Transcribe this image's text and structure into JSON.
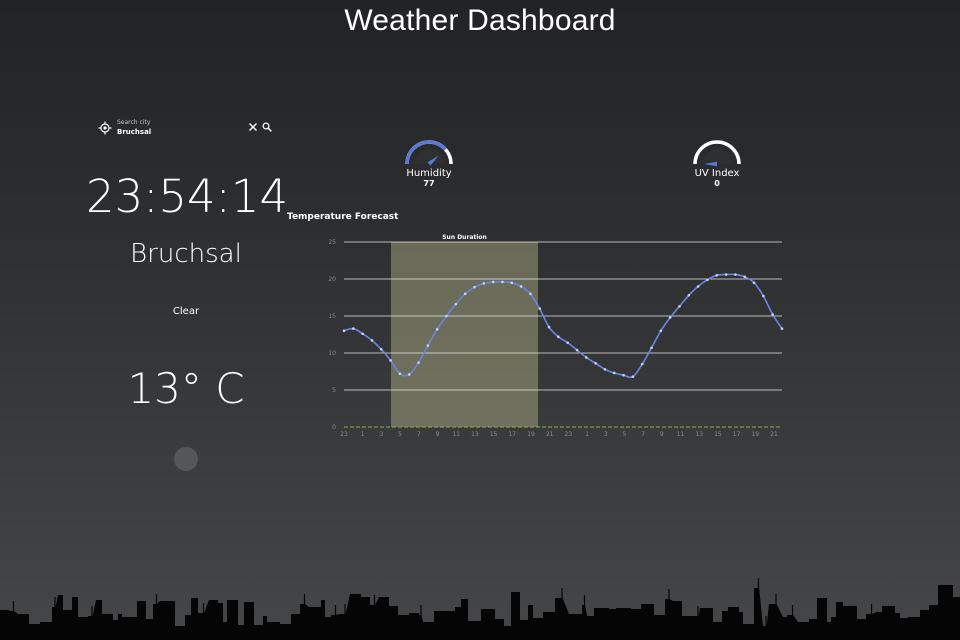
{
  "app": {
    "title": "Weather Dashboard"
  },
  "search": {
    "label": "Search city",
    "value": "Bruchsal"
  },
  "current": {
    "time": "23:54:14",
    "city": "Bruchsal",
    "condition": "Clear",
    "temperature": "13° C"
  },
  "gauges": {
    "humidity": {
      "label": "Humidity",
      "value": "77",
      "fraction": 0.77
    },
    "uv": {
      "label": "UV Index",
      "value": "0",
      "fraction": 0.0
    }
  },
  "colors": {
    "accent": "#5a78d8",
    "gauge_track": "#ffffff",
    "sun_band": "#b4b48a",
    "line": "#6a86e0",
    "baseline": "#8fb04e"
  },
  "chart_data": {
    "type": "line",
    "title": "Temperature Forecast",
    "band_label": "Sun Duration",
    "x_tick_labels": [
      "23",
      "1",
      "3",
      "5",
      "7",
      "9",
      "11",
      "13",
      "15",
      "17",
      "19",
      "21",
      "23",
      "1",
      "3",
      "5",
      "7",
      "9",
      "11",
      "13",
      "15",
      "17",
      "19",
      "21"
    ],
    "y_ticks": [
      0,
      5,
      10,
      15,
      20,
      25
    ],
    "ylim": [
      0,
      25
    ],
    "sun_band_hour_index": [
      5,
      21
    ],
    "series": [
      {
        "values": [
          13,
          13.3,
          12.6,
          11.7,
          10.5,
          9,
          7.2,
          7.1,
          8.7,
          11,
          13.2,
          15,
          16.6,
          18,
          18.9,
          19.4,
          19.6,
          19.6,
          19.5,
          19,
          18,
          16,
          13.5,
          12.2,
          11.4,
          10.4,
          9.4,
          8.6,
          7.8,
          7.3,
          7,
          6.8,
          8.5,
          10.7,
          13,
          14.8,
          16.3,
          17.8,
          19,
          19.9,
          20.5,
          20.6,
          20.6,
          20.3,
          19.5,
          17.7,
          15.2,
          13.3
        ]
      }
    ],
    "grid": "horizontal"
  }
}
